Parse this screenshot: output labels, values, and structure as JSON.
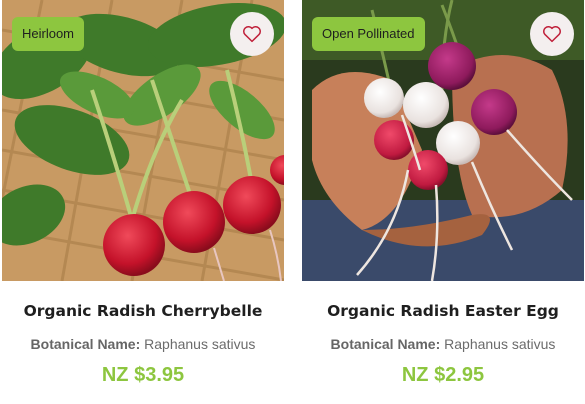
{
  "colors": {
    "badge": "#8dc63f",
    "price": "#8dc63f",
    "fav_bg": "#f4efef",
    "heart": "#c0213b"
  },
  "products": [
    {
      "badge": "Heirloom",
      "title": "Organic Radish Cherrybelle",
      "botanical_label": "Botanical Name:",
      "botanical_value": "Raphanus sativus",
      "price": "NZ $3.95",
      "fav_icon": "heart-outline-icon"
    },
    {
      "badge": "Open Pollinated",
      "title": "Organic Radish Easter Egg",
      "botanical_label": "Botanical Name:",
      "botanical_value": "Raphanus sativus",
      "price": "NZ $2.95",
      "fav_icon": "heart-outline-icon"
    }
  ]
}
